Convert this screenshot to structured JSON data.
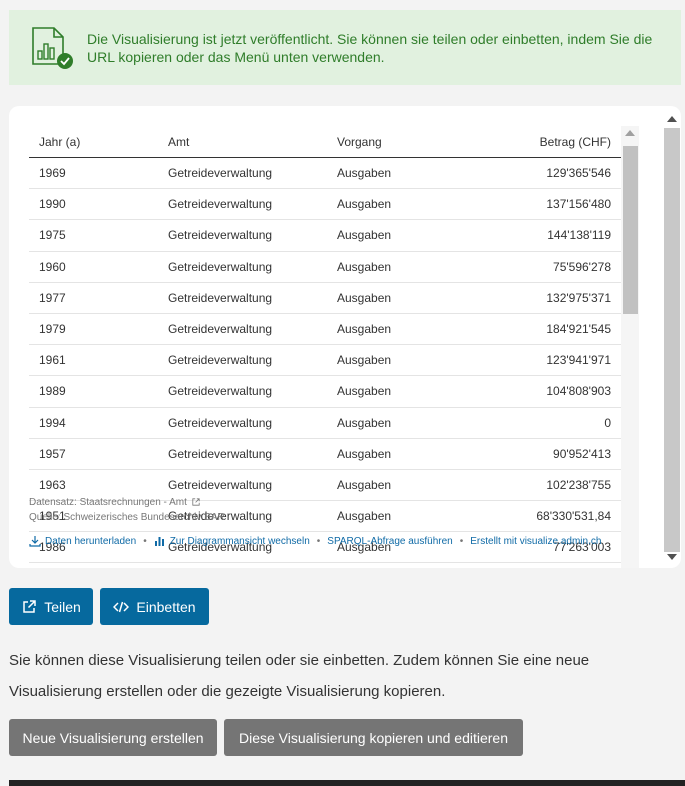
{
  "banner": {
    "message": "Die Visualisierung ist jetzt veröffentlicht. Sie können sie teilen oder einbetten, indem Sie die URL kopieren oder das Menü unten verwenden.",
    "icon": "chart-check-icon",
    "color": "#2f7d2a"
  },
  "table": {
    "columns": [
      "Jahr (a)",
      "Amt",
      "Vorgang",
      "Betrag (CHF)"
    ],
    "rows": [
      [
        "1969",
        "Getreideverwaltung",
        "Ausgaben",
        "129'365'546"
      ],
      [
        "1990",
        "Getreideverwaltung",
        "Ausgaben",
        "137'156'480"
      ],
      [
        "1975",
        "Getreideverwaltung",
        "Ausgaben",
        "144'138'119"
      ],
      [
        "1960",
        "Getreideverwaltung",
        "Ausgaben",
        "75'596'278"
      ],
      [
        "1977",
        "Getreideverwaltung",
        "Ausgaben",
        "132'975'371"
      ],
      [
        "1979",
        "Getreideverwaltung",
        "Ausgaben",
        "184'921'545"
      ],
      [
        "1961",
        "Getreideverwaltung",
        "Ausgaben",
        "123'941'971"
      ],
      [
        "1989",
        "Getreideverwaltung",
        "Ausgaben",
        "104'808'903"
      ],
      [
        "1994",
        "Getreideverwaltung",
        "Ausgaben",
        "0"
      ],
      [
        "1957",
        "Getreideverwaltung",
        "Ausgaben",
        "90'952'413"
      ],
      [
        "1963",
        "Getreideverwaltung",
        "Ausgaben",
        "102'238'755"
      ],
      [
        "1951",
        "Getreideverwaltung",
        "Ausgaben",
        "68'330'531,84"
      ],
      [
        "1986",
        "Getreideverwaltung",
        "Ausgaben",
        "77'263'003"
      ]
    ]
  },
  "meta": {
    "dataset": "Datensatz: Staatsrechnungen - Amt",
    "source": "Quelle: Schweizerisches Bundesarchiv BAR",
    "links": {
      "download": "Daten herunterladen",
      "chart_view": "Zur Diagrammansicht wechseln",
      "sparql": "SPARQL-Abfrage ausführen",
      "created": "Erstellt mit visualize.admin.ch"
    },
    "link_color": "#0f6aa6"
  },
  "actions": {
    "share_label": "Teilen",
    "embed_label": "Einbetten",
    "primary_color": "#06699e"
  },
  "info_text": "Sie können diese Visualisierung teilen oder sie einbetten. Zudem können Sie eine neue Visualisierung erstellen oder die gezeigte Visualisierung kopieren.",
  "bottom_actions": {
    "new_label": "Neue Visualisierung erstellen",
    "copy_label": "Diese Visualisierung kopieren und editieren",
    "color": "#757575"
  }
}
